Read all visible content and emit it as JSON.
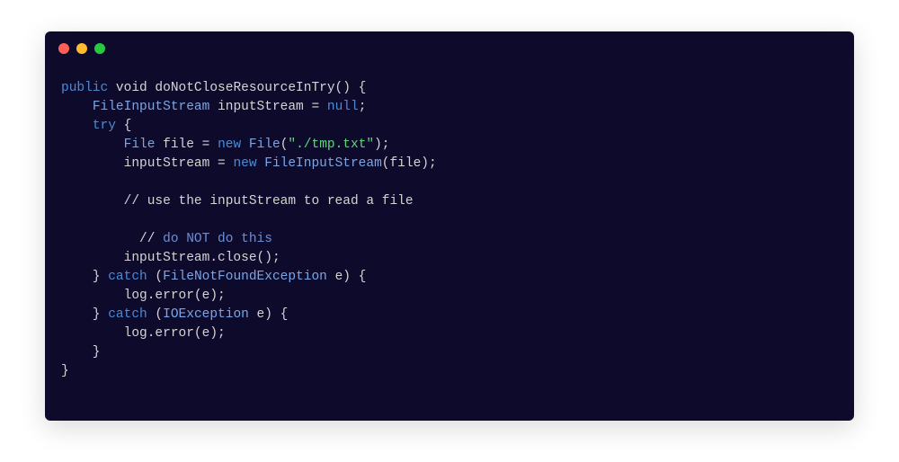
{
  "window": {
    "traffic_lights": [
      "close",
      "minimize",
      "zoom"
    ]
  },
  "code": {
    "lines": [
      [
        {
          "t": "public",
          "c": "kw"
        },
        {
          "t": " void doNotCloseResourceInTry() {",
          "c": "ident"
        }
      ],
      [
        {
          "t": "    ",
          "c": "ident"
        },
        {
          "t": "FileInputStream",
          "c": "type"
        },
        {
          "t": " inputStream = ",
          "c": "ident"
        },
        {
          "t": "null",
          "c": "kw"
        },
        {
          "t": ";",
          "c": "ident"
        }
      ],
      [
        {
          "t": "    ",
          "c": "ident"
        },
        {
          "t": "try",
          "c": "kw"
        },
        {
          "t": " {",
          "c": "ident"
        }
      ],
      [
        {
          "t": "        ",
          "c": "ident"
        },
        {
          "t": "File",
          "c": "type"
        },
        {
          "t": " file = ",
          "c": "ident"
        },
        {
          "t": "new",
          "c": "kw"
        },
        {
          "t": " ",
          "c": "ident"
        },
        {
          "t": "File",
          "c": "type"
        },
        {
          "t": "(",
          "c": "ident"
        },
        {
          "t": "\"./tmp.txt\"",
          "c": "str"
        },
        {
          "t": ");",
          "c": "ident"
        }
      ],
      [
        {
          "t": "        inputStream = ",
          "c": "ident"
        },
        {
          "t": "new",
          "c": "kw"
        },
        {
          "t": " ",
          "c": "ident"
        },
        {
          "t": "FileInputStream",
          "c": "type"
        },
        {
          "t": "(file);",
          "c": "ident"
        }
      ],
      [
        {
          "t": " ",
          "c": "ident"
        }
      ],
      [
        {
          "t": "        // use the inputStream to read a file",
          "c": "ident"
        }
      ],
      [
        {
          "t": " ",
          "c": "ident"
        }
      ],
      [
        {
          "t": "          // ",
          "c": "ident"
        },
        {
          "t": "do NOT do this",
          "c": "cmt2"
        }
      ],
      [
        {
          "t": "        inputStream.close();",
          "c": "ident"
        }
      ],
      [
        {
          "t": "    } ",
          "c": "ident"
        },
        {
          "t": "catch",
          "c": "kw"
        },
        {
          "t": " (",
          "c": "ident"
        },
        {
          "t": "FileNotFoundException",
          "c": "type"
        },
        {
          "t": " e) {",
          "c": "ident"
        }
      ],
      [
        {
          "t": "        log.error(e);",
          "c": "ident"
        }
      ],
      [
        {
          "t": "    } ",
          "c": "ident"
        },
        {
          "t": "catch",
          "c": "kw"
        },
        {
          "t": " (",
          "c": "ident"
        },
        {
          "t": "IOException",
          "c": "type"
        },
        {
          "t": " e) {",
          "c": "ident"
        }
      ],
      [
        {
          "t": "        log.error(e);",
          "c": "ident"
        }
      ],
      [
        {
          "t": "    }",
          "c": "ident"
        }
      ],
      [
        {
          "t": "}",
          "c": "ident"
        }
      ]
    ]
  }
}
